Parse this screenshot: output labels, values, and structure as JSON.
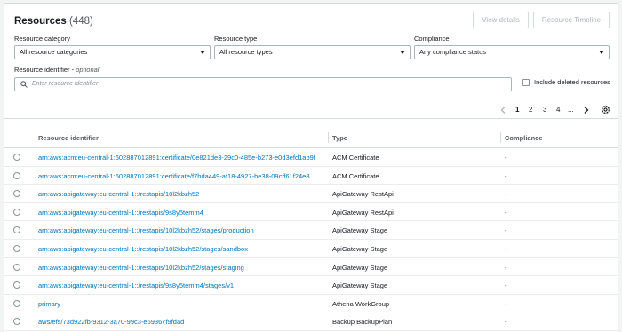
{
  "header": {
    "title": "Resources",
    "count": "(448)",
    "view_details_label": "View details",
    "timeline_label": "Resource Timeline"
  },
  "filters": {
    "category": {
      "label": "Resource category",
      "value": "All resource categories"
    },
    "type": {
      "label": "Resource type",
      "value": "All resource types"
    },
    "compliance": {
      "label": "Compliance",
      "value": "Any compliance status"
    },
    "identifier": {
      "label": "Resource identifier",
      "label_suffix": "optional",
      "placeholder": "Enter resource identifier"
    },
    "include_deleted": {
      "label": "Include deleted resources",
      "checked": false
    }
  },
  "pagination": {
    "pages": [
      "1",
      "2",
      "3",
      "4"
    ],
    "ellipsis": "...",
    "current": "1"
  },
  "table": {
    "headers": {
      "id": "Resource identifier",
      "type": "Type",
      "compliance": "Compliance"
    },
    "rows": [
      {
        "id": "arn:aws:acm:eu-central-1:602887012891:certificate/0e821de3-29c0-485e-b273-e0d3efd1ab9f",
        "type": "ACM Certificate",
        "compliance": "-"
      },
      {
        "id": "arn:aws:acm:eu-central-1:602887012891:certificate/f7bda449-af18-4927-be38-09cff61f24e8",
        "type": "ACM Certificate",
        "compliance": "-"
      },
      {
        "id": "arn:aws:apigateway:eu-central-1::/restapis/10l2kbzh52",
        "type": "ApiGateway RestApi",
        "compliance": "-"
      },
      {
        "id": "arn:aws:apigateway:eu-central-1::/restapis/9s8y5temm4",
        "type": "ApiGateway RestApi",
        "compliance": "-"
      },
      {
        "id": "arn:aws:apigateway:eu-central-1::/restapis/10l2kbzh52/stages/production",
        "type": "ApiGateway Stage",
        "compliance": "-"
      },
      {
        "id": "arn:aws:apigateway:eu-central-1::/restapis/10l2kbzh52/stages/sandbox",
        "type": "ApiGateway Stage",
        "compliance": "-"
      },
      {
        "id": "arn:aws:apigateway:eu-central-1::/restapis/10l2kbzh52/stages/staging",
        "type": "ApiGateway Stage",
        "compliance": "-"
      },
      {
        "id": "arn:aws:apigateway:eu-central-1::/restapis/9s8y5temm4/stages/v1",
        "type": "ApiGateway Stage",
        "compliance": "-"
      },
      {
        "id": "primary",
        "type": "Athena WorkGroup",
        "compliance": "-"
      },
      {
        "id": "aws/efs/73d922fb-9312-3a70-99c3-e69367f9fdad",
        "type": "Backup BackupPlan",
        "compliance": "-"
      }
    ]
  }
}
